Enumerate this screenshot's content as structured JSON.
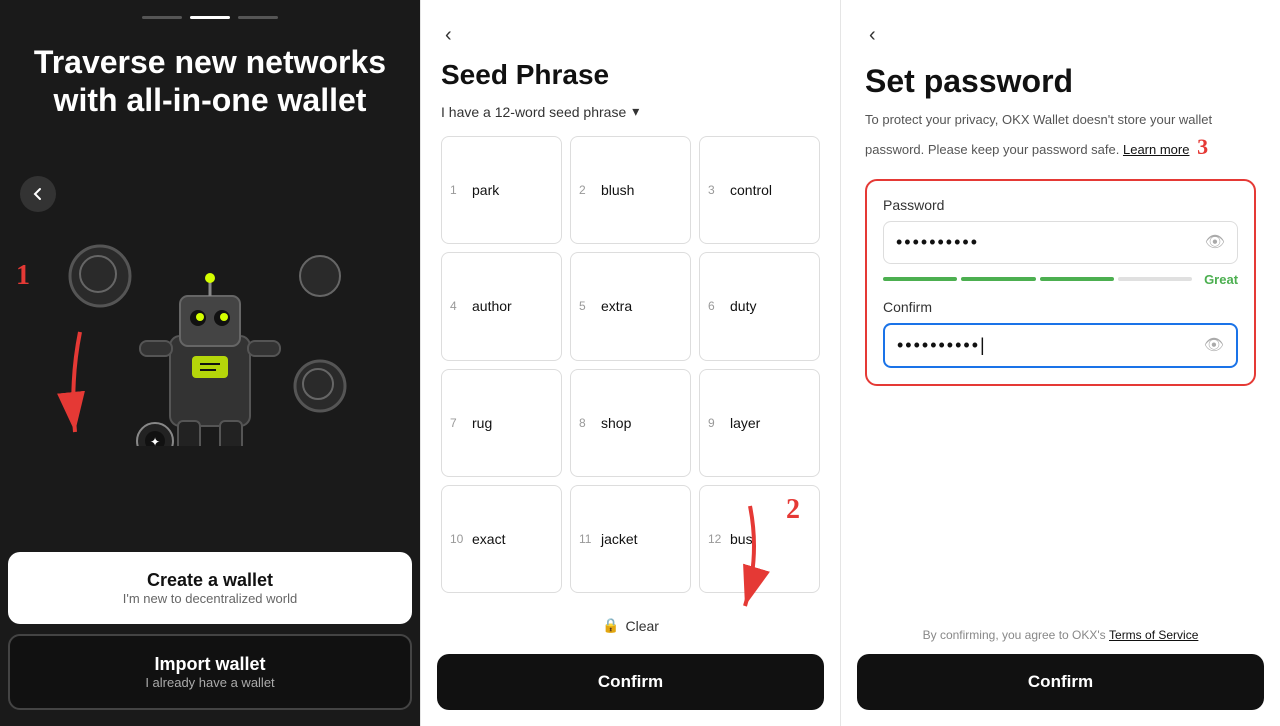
{
  "panel1": {
    "progress_dots": [
      false,
      true,
      false
    ],
    "title": "Traverse new networks with all-in-one wallet",
    "back_label": "←",
    "create_wallet": {
      "main": "Create a wallet",
      "sub": "I'm new to decentralized world"
    },
    "import_wallet": {
      "main": "Import wallet",
      "sub": "I already have a wallet"
    },
    "annotation_1": "1"
  },
  "panel2": {
    "back_label": "‹",
    "title": "Seed Phrase",
    "dropdown_label": "I have a 12-word seed phrase",
    "words": [
      {
        "num": "1",
        "word": "park"
      },
      {
        "num": "2",
        "word": "blush"
      },
      {
        "num": "3",
        "word": "control"
      },
      {
        "num": "4",
        "word": "author"
      },
      {
        "num": "5",
        "word": "extra"
      },
      {
        "num": "6",
        "word": "duty"
      },
      {
        "num": "7",
        "word": "rug"
      },
      {
        "num": "8",
        "word": "shop"
      },
      {
        "num": "9",
        "word": "layer"
      },
      {
        "num": "10",
        "word": "exact"
      },
      {
        "num": "11",
        "word": "jacket"
      },
      {
        "num": "12",
        "word": "bus"
      }
    ],
    "clear_label": "Clear",
    "confirm_label": "Confirm",
    "annotation_2": "2"
  },
  "panel3": {
    "back_label": "‹",
    "title": "Set password",
    "description": "To protect your privacy, OKX Wallet doesn't store your wallet password. Please keep your password safe.",
    "learn_more": "Learn more",
    "annotation_3": "3",
    "password_label": "Password",
    "password_value": "••••••••••",
    "strength_label": "Great",
    "confirm_label": "Confirm",
    "confirm_value": "••••••••••",
    "eye_icon": "👁",
    "terms_text": "By confirming, you agree to OKX's",
    "terms_link": "Terms of Service",
    "confirm_btn": "Confirm"
  }
}
